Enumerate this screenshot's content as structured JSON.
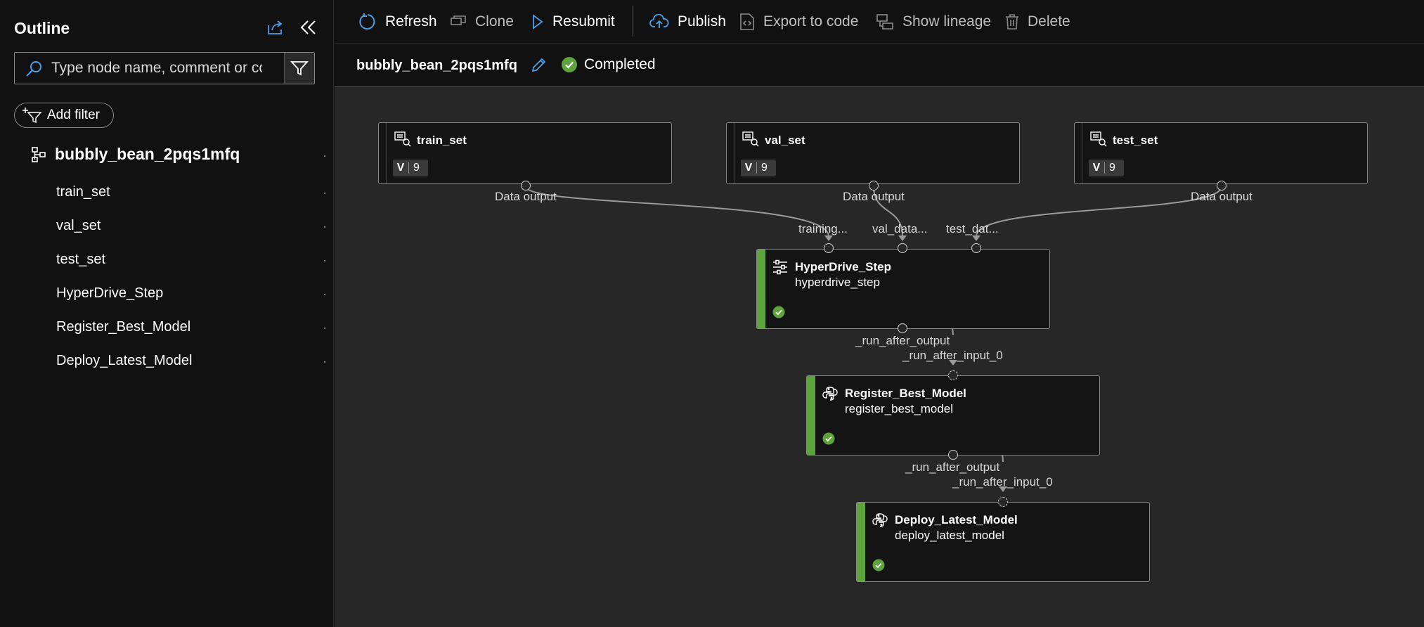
{
  "sidebar": {
    "title": "Outline",
    "search": {
      "placeholder": "Type node name, comment or co..."
    },
    "add_filter_label": "Add filter",
    "root": {
      "label": "bubbly_bean_2pqs1mfq"
    },
    "items": [
      {
        "label": "train_set"
      },
      {
        "label": "val_set"
      },
      {
        "label": "test_set"
      },
      {
        "label": "HyperDrive_Step"
      },
      {
        "label": "Register_Best_Model"
      },
      {
        "label": "Deploy_Latest_Model"
      }
    ]
  },
  "toolbar": {
    "refresh": "Refresh",
    "clone": "Clone",
    "resubmit": "Resubmit",
    "publish": "Publish",
    "export": "Export to code",
    "lineage": "Show lineage",
    "delete": "Delete"
  },
  "header": {
    "run_name": "bubbly_bean_2pqs1mfq",
    "status": "Completed"
  },
  "graph": {
    "datasets": [
      {
        "name": "train_set",
        "version_prefix": "V",
        "version": "9",
        "output_label": "Data output"
      },
      {
        "name": "val_set",
        "version_prefix": "V",
        "version": "9",
        "output_label": "Data output"
      },
      {
        "name": "test_set",
        "version_prefix": "V",
        "version": "9",
        "output_label": "Data output"
      }
    ],
    "steps": [
      {
        "name": "HyperDrive_Step",
        "sub": "hyperdrive_step",
        "inputs": [
          "training...",
          "val_data...",
          "test_dat..."
        ],
        "output_label": "_run_after_output"
      },
      {
        "name": "Register_Best_Model",
        "sub": "register_best_model",
        "input_label": "_run_after_input_0",
        "output_label": "_run_after_output"
      },
      {
        "name": "Deploy_Latest_Model",
        "sub": "deploy_latest_model",
        "input_label": "_run_after_input_0"
      }
    ]
  },
  "colors": {
    "accent": "#5ea43c",
    "link": "#4a9fe8",
    "canvas": "#272727",
    "background": "#111111"
  }
}
